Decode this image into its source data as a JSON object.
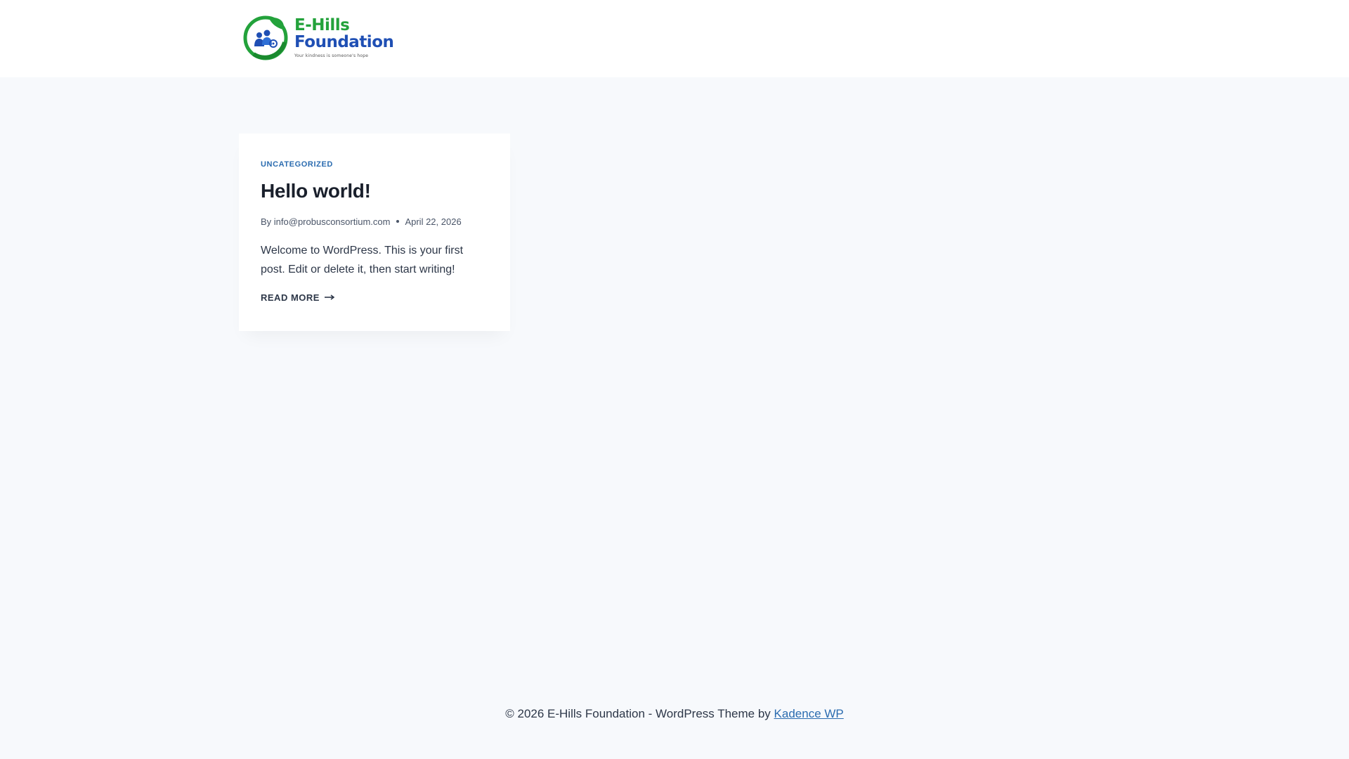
{
  "header": {
    "logo": {
      "line1": "E-Hills",
      "line2": "Foundation",
      "tagline": "Your kindness is someone's hope",
      "colors": {
        "green": "#23a23b",
        "blue": "#1f4fb4"
      }
    }
  },
  "post": {
    "category": "Uncategorized",
    "title": "Hello world!",
    "meta": {
      "by": "By",
      "author": "info@probusconsortium.com",
      "date": "April 22, 2026"
    },
    "excerpt": "Welcome to WordPress. This is your first post. Edit or delete it, then start writing!",
    "read_more": "Read More",
    "read_more_icon": "arrow-right-icon"
  },
  "footer": {
    "text": "© 2026 E-Hills Foundation - WordPress Theme by ",
    "link_text": "Kadence WP"
  },
  "colors": {
    "background": "#f7f9fc",
    "link": "#2b6cb0",
    "heading": "#1a202c"
  }
}
